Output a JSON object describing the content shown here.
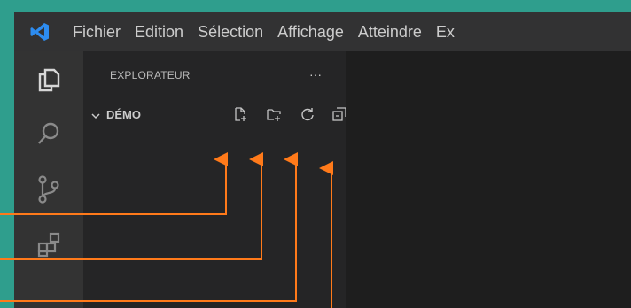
{
  "menubar": {
    "items": [
      "Fichier",
      "Edition",
      "Sélection",
      "Affichage",
      "Atteindre",
      "Ex"
    ]
  },
  "activitybar": {
    "icons": [
      "explorer-icon",
      "search-icon",
      "source-control-icon",
      "extensions-icon"
    ]
  },
  "sidebar": {
    "title": "EXPLORATEUR",
    "more_label": "···",
    "folder": {
      "name": "DÉMO",
      "actions": [
        "new-file-icon",
        "new-folder-icon",
        "refresh-icon",
        "collapse-all-icon"
      ]
    }
  },
  "colors": {
    "background": "#2f9e8d",
    "menubar": "#323233",
    "activitybar": "#333333",
    "sidebar": "#252526",
    "editor": "#1e1e1e",
    "accent": "#2d8cf0",
    "annotation": "#ff7a1a"
  }
}
